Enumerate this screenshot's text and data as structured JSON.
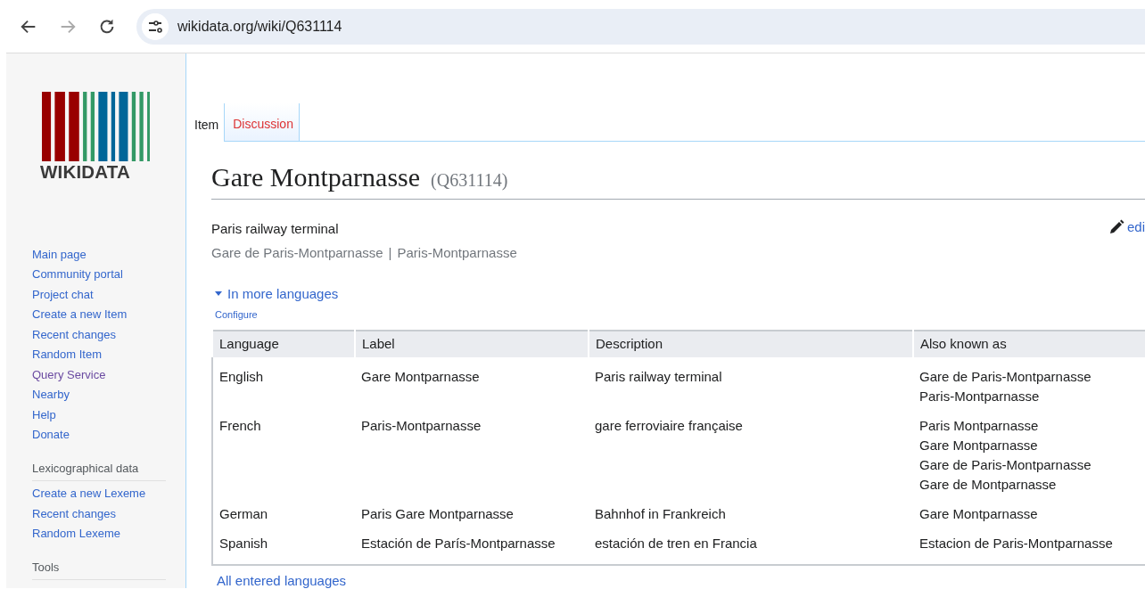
{
  "browser": {
    "url": "wikidata.org/wiki/Q631114"
  },
  "logo": {
    "wordmark": "WIKIDATA"
  },
  "sidebar": {
    "groups": [
      {
        "items": [
          {
            "label": "Main page",
            "visited": false
          },
          {
            "label": "Community portal",
            "visited": false
          },
          {
            "label": "Project chat",
            "visited": false
          },
          {
            "label": "Create a new Item",
            "visited": false
          },
          {
            "label": "Recent changes",
            "visited": false
          },
          {
            "label": "Random Item",
            "visited": false
          },
          {
            "label": "Query Service",
            "visited": true
          },
          {
            "label": "Nearby",
            "visited": false
          },
          {
            "label": "Help",
            "visited": false
          },
          {
            "label": "Donate",
            "visited": false
          }
        ]
      },
      {
        "heading": "Lexicographical data",
        "items": [
          {
            "label": "Create a new Lexeme",
            "visited": false
          },
          {
            "label": "Recent changes",
            "visited": false
          },
          {
            "label": "Random Lexeme",
            "visited": false
          }
        ]
      },
      {
        "heading": "Tools"
      }
    ]
  },
  "tabs": [
    {
      "label": "Item",
      "selected": true
    },
    {
      "label": "Discussion",
      "selected": false
    }
  ],
  "page": {
    "title": "Gare Montparnasse",
    "id": "(Q631114)",
    "description": "Paris railway terminal",
    "aliases": [
      "Gare de Paris-Montparnasse",
      "Paris-Montparnasse"
    ],
    "alias_separator": "|",
    "edit": "edi",
    "toggle": "In more languages",
    "configure": "Configure",
    "more_link": "All entered languages"
  },
  "table": {
    "columns": [
      "Language",
      "Label",
      "Description",
      "Also known as"
    ],
    "rows": [
      {
        "language": "English",
        "label": "Gare Montparnasse",
        "description": "Paris railway terminal",
        "aliases": [
          "Gare de Paris-Montparnasse",
          "Paris-Montparnasse"
        ]
      },
      {
        "language": "French",
        "label": "Paris-Montparnasse",
        "description": "gare ferroviaire française",
        "aliases": [
          "Paris Montparnasse",
          "Gare Montparnasse",
          "Gare de Paris-Montparnasse",
          "Gare de Montparnasse"
        ]
      },
      {
        "language": "German",
        "label": "Paris Gare Montparnasse",
        "description": "Bahnhof in Frankreich",
        "aliases": [
          "Gare Montparnasse"
        ]
      },
      {
        "language": "Spanish",
        "label": "Estación de París-Montparnasse",
        "description": "estación de tren en Francia",
        "aliases": [
          "Estacion de Paris-Montparnasse"
        ]
      }
    ]
  }
}
